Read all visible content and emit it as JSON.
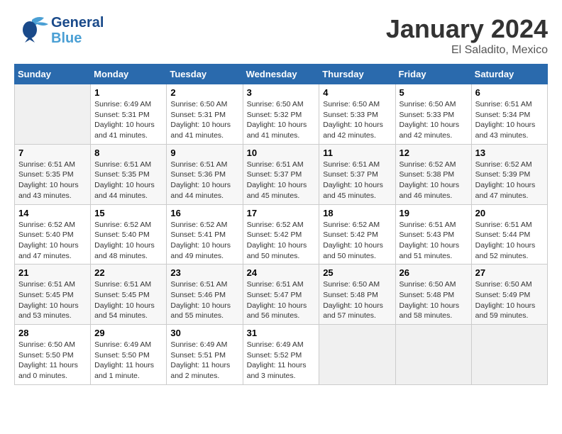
{
  "header": {
    "logo_line1": "General",
    "logo_line2": "Blue",
    "month": "January 2024",
    "location": "El Saladito, Mexico"
  },
  "weekdays": [
    "Sunday",
    "Monday",
    "Tuesday",
    "Wednesday",
    "Thursday",
    "Friday",
    "Saturday"
  ],
  "weeks": [
    [
      {
        "day": "",
        "sunrise": "",
        "sunset": "",
        "daylight": ""
      },
      {
        "day": "1",
        "sunrise": "Sunrise: 6:49 AM",
        "sunset": "Sunset: 5:31 PM",
        "daylight": "Daylight: 10 hours and 41 minutes."
      },
      {
        "day": "2",
        "sunrise": "Sunrise: 6:50 AM",
        "sunset": "Sunset: 5:31 PM",
        "daylight": "Daylight: 10 hours and 41 minutes."
      },
      {
        "day": "3",
        "sunrise": "Sunrise: 6:50 AM",
        "sunset": "Sunset: 5:32 PM",
        "daylight": "Daylight: 10 hours and 41 minutes."
      },
      {
        "day": "4",
        "sunrise": "Sunrise: 6:50 AM",
        "sunset": "Sunset: 5:33 PM",
        "daylight": "Daylight: 10 hours and 42 minutes."
      },
      {
        "day": "5",
        "sunrise": "Sunrise: 6:50 AM",
        "sunset": "Sunset: 5:33 PM",
        "daylight": "Daylight: 10 hours and 42 minutes."
      },
      {
        "day": "6",
        "sunrise": "Sunrise: 6:51 AM",
        "sunset": "Sunset: 5:34 PM",
        "daylight": "Daylight: 10 hours and 43 minutes."
      }
    ],
    [
      {
        "day": "7",
        "sunrise": "Sunrise: 6:51 AM",
        "sunset": "Sunset: 5:35 PM",
        "daylight": "Daylight: 10 hours and 43 minutes."
      },
      {
        "day": "8",
        "sunrise": "Sunrise: 6:51 AM",
        "sunset": "Sunset: 5:35 PM",
        "daylight": "Daylight: 10 hours and 44 minutes."
      },
      {
        "day": "9",
        "sunrise": "Sunrise: 6:51 AM",
        "sunset": "Sunset: 5:36 PM",
        "daylight": "Daylight: 10 hours and 44 minutes."
      },
      {
        "day": "10",
        "sunrise": "Sunrise: 6:51 AM",
        "sunset": "Sunset: 5:37 PM",
        "daylight": "Daylight: 10 hours and 45 minutes."
      },
      {
        "day": "11",
        "sunrise": "Sunrise: 6:51 AM",
        "sunset": "Sunset: 5:37 PM",
        "daylight": "Daylight: 10 hours and 45 minutes."
      },
      {
        "day": "12",
        "sunrise": "Sunrise: 6:52 AM",
        "sunset": "Sunset: 5:38 PM",
        "daylight": "Daylight: 10 hours and 46 minutes."
      },
      {
        "day": "13",
        "sunrise": "Sunrise: 6:52 AM",
        "sunset": "Sunset: 5:39 PM",
        "daylight": "Daylight: 10 hours and 47 minutes."
      }
    ],
    [
      {
        "day": "14",
        "sunrise": "Sunrise: 6:52 AM",
        "sunset": "Sunset: 5:40 PM",
        "daylight": "Daylight: 10 hours and 47 minutes."
      },
      {
        "day": "15",
        "sunrise": "Sunrise: 6:52 AM",
        "sunset": "Sunset: 5:40 PM",
        "daylight": "Daylight: 10 hours and 48 minutes."
      },
      {
        "day": "16",
        "sunrise": "Sunrise: 6:52 AM",
        "sunset": "Sunset: 5:41 PM",
        "daylight": "Daylight: 10 hours and 49 minutes."
      },
      {
        "day": "17",
        "sunrise": "Sunrise: 6:52 AM",
        "sunset": "Sunset: 5:42 PM",
        "daylight": "Daylight: 10 hours and 50 minutes."
      },
      {
        "day": "18",
        "sunrise": "Sunrise: 6:52 AM",
        "sunset": "Sunset: 5:42 PM",
        "daylight": "Daylight: 10 hours and 50 minutes."
      },
      {
        "day": "19",
        "sunrise": "Sunrise: 6:51 AM",
        "sunset": "Sunset: 5:43 PM",
        "daylight": "Daylight: 10 hours and 51 minutes."
      },
      {
        "day": "20",
        "sunrise": "Sunrise: 6:51 AM",
        "sunset": "Sunset: 5:44 PM",
        "daylight": "Daylight: 10 hours and 52 minutes."
      }
    ],
    [
      {
        "day": "21",
        "sunrise": "Sunrise: 6:51 AM",
        "sunset": "Sunset: 5:45 PM",
        "daylight": "Daylight: 10 hours and 53 minutes."
      },
      {
        "day": "22",
        "sunrise": "Sunrise: 6:51 AM",
        "sunset": "Sunset: 5:45 PM",
        "daylight": "Daylight: 10 hours and 54 minutes."
      },
      {
        "day": "23",
        "sunrise": "Sunrise: 6:51 AM",
        "sunset": "Sunset: 5:46 PM",
        "daylight": "Daylight: 10 hours and 55 minutes."
      },
      {
        "day": "24",
        "sunrise": "Sunrise: 6:51 AM",
        "sunset": "Sunset: 5:47 PM",
        "daylight": "Daylight: 10 hours and 56 minutes."
      },
      {
        "day": "25",
        "sunrise": "Sunrise: 6:50 AM",
        "sunset": "Sunset: 5:48 PM",
        "daylight": "Daylight: 10 hours and 57 minutes."
      },
      {
        "day": "26",
        "sunrise": "Sunrise: 6:50 AM",
        "sunset": "Sunset: 5:48 PM",
        "daylight": "Daylight: 10 hours and 58 minutes."
      },
      {
        "day": "27",
        "sunrise": "Sunrise: 6:50 AM",
        "sunset": "Sunset: 5:49 PM",
        "daylight": "Daylight: 10 hours and 59 minutes."
      }
    ],
    [
      {
        "day": "28",
        "sunrise": "Sunrise: 6:50 AM",
        "sunset": "Sunset: 5:50 PM",
        "daylight": "Daylight: 11 hours and 0 minutes."
      },
      {
        "day": "29",
        "sunrise": "Sunrise: 6:49 AM",
        "sunset": "Sunset: 5:50 PM",
        "daylight": "Daylight: 11 hours and 1 minute."
      },
      {
        "day": "30",
        "sunrise": "Sunrise: 6:49 AM",
        "sunset": "Sunset: 5:51 PM",
        "daylight": "Daylight: 11 hours and 2 minutes."
      },
      {
        "day": "31",
        "sunrise": "Sunrise: 6:49 AM",
        "sunset": "Sunset: 5:52 PM",
        "daylight": "Daylight: 11 hours and 3 minutes."
      },
      {
        "day": "",
        "sunrise": "",
        "sunset": "",
        "daylight": ""
      },
      {
        "day": "",
        "sunrise": "",
        "sunset": "",
        "daylight": ""
      },
      {
        "day": "",
        "sunrise": "",
        "sunset": "",
        "daylight": ""
      }
    ]
  ]
}
